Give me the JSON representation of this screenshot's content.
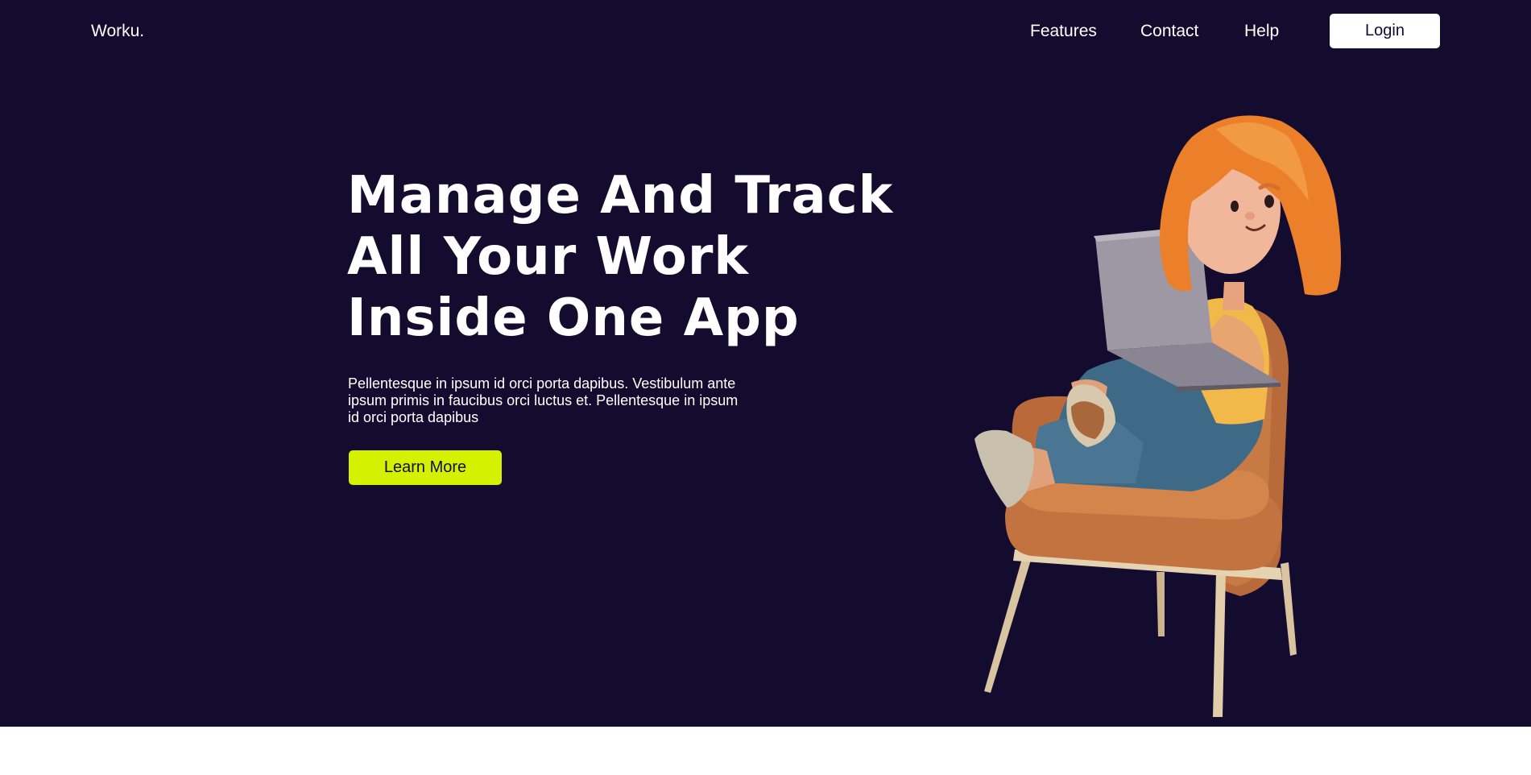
{
  "brand": {
    "logo_text": "Worku."
  },
  "nav": {
    "features_label": "Features",
    "contact_label": "Contact",
    "help_label": "Help",
    "login_label": "Login"
  },
  "hero": {
    "headline_lines": [
      "Manage And Track",
      "All Your Work",
      "Inside One App"
    ],
    "description": "Pellentesque in ipsum id orci porta dapibus. Vestibulum ante ipsum primis in faucibus orci luctus et. Pellentesque in ipsum id orci porta dapibus",
    "cta_label": "Learn More"
  },
  "colors": {
    "hero_background": "#130c2e",
    "accent": "#d4f200",
    "text_light": "#ffffff",
    "page_background": "#ffffff"
  },
  "illustration": {
    "subject": "woman-with-laptop-in-armchair"
  }
}
